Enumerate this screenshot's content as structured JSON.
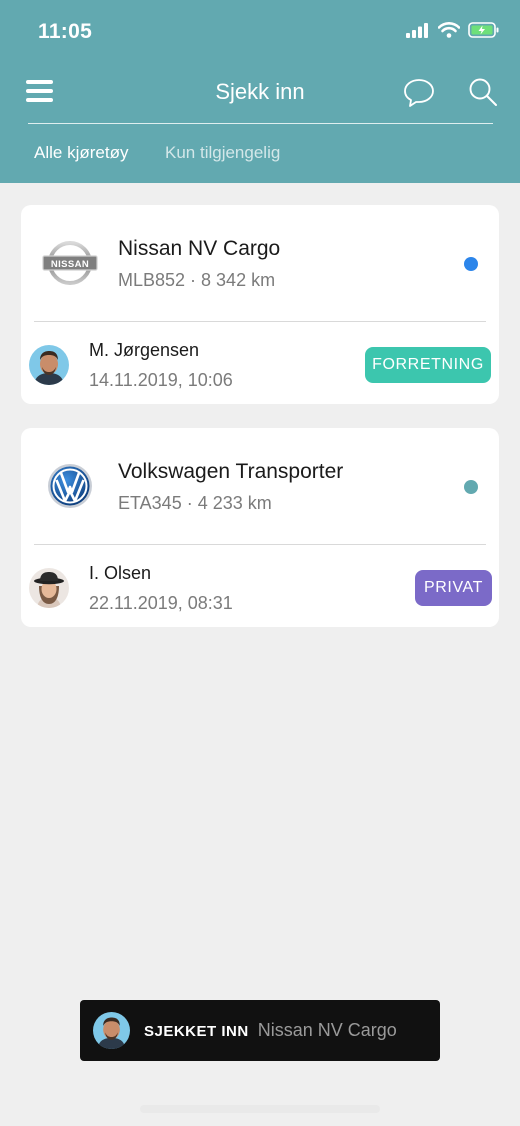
{
  "status_bar": {
    "time": "11:05"
  },
  "nav": {
    "title": "Sjekk inn"
  },
  "tabs": [
    {
      "label": "Alle kjøretøy",
      "active": true
    },
    {
      "label": "Kun tilgjengelig",
      "active": false
    }
  ],
  "vehicles": [
    {
      "name": "Nissan NV Cargo",
      "meta": "MLB852 · 8 342 km",
      "logo": "nissan-logo",
      "status_color": "#2c85ea",
      "user": {
        "name": "M. Jørgensen",
        "time": "14.11.2019, 10:06"
      },
      "badge": {
        "label": "FORRETNING",
        "color": "#3cc6ae"
      }
    },
    {
      "name": "Volkswagen Transporter",
      "meta": "ETA345 · 4 233 km",
      "logo": "volkswagen-logo",
      "status_color": "#62a9b0",
      "user": {
        "name": "I. Olsen",
        "time": "22.11.2019, 08:31"
      },
      "badge": {
        "label": "PRIVAT",
        "color": "#7b6ac8"
      }
    }
  ],
  "toast": {
    "label": "SJEKKET INN",
    "vehicle": "Nissan NV Cargo"
  },
  "colors": {
    "header_bg": "#62a9b0",
    "page_bg": "#efefef",
    "toast_bg": "#111111"
  }
}
